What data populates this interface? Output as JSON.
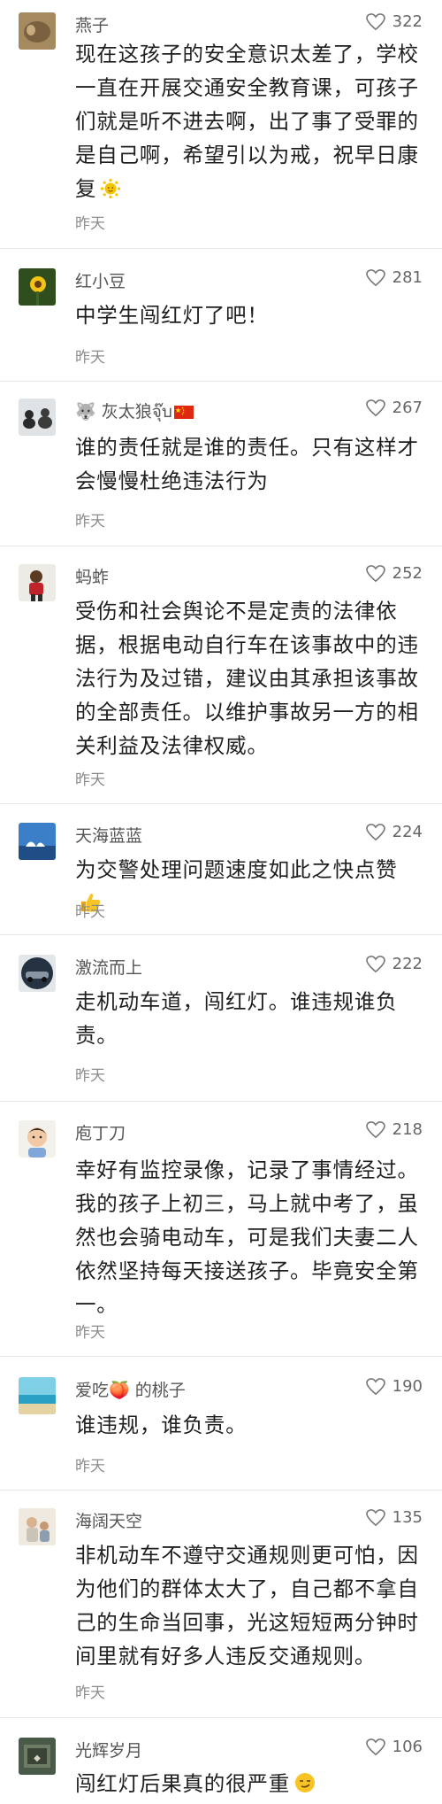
{
  "comments": [
    {
      "name": "燕子",
      "likes": "322",
      "text": "现在这孩子的安全意识太差了，学校一直在开展交通安全教育课，可孩子们就是听不进去啊，出了事了受罪的是自己啊，希望引以为戒，祝早日康复",
      "emoji": "sun-face-emoji",
      "time": "昨天"
    },
    {
      "name": "红小豆",
      "likes": "281",
      "text": "中学生闯红灯了吧！",
      "time": "昨天"
    },
    {
      "name": "🐺 灰太狼จุ๊บ",
      "likes": "267",
      "text": "谁的责任就是谁的责任。只有这样才会慢慢杜绝违法行为",
      "name_icon": "china-flag-icon",
      "time": "昨天"
    },
    {
      "name": "蚂蚱",
      "likes": "252",
      "text": "受伤和社会舆论不是定责的法律依据，根据电动自行车在该事故中的违法行为及过错，建议由其承担该事故的全部责任。以维护事故另一方的相关利益及法律权威。",
      "time": "昨天"
    },
    {
      "name": "天海蓝蓝",
      "likes": "224",
      "text": "为交警处理问题速度如此之快点赞",
      "emoji": "thumbs-up-emoji",
      "time": "昨天"
    },
    {
      "name": "激流而上",
      "likes": "222",
      "text": "走机动车道，闯红灯。谁违规谁负责。",
      "time": "昨天"
    },
    {
      "name": "庖丁刀",
      "likes": "218",
      "text": "幸好有监控录像，记录了事情经过。我的孩子上初三，马上就中考了，虽然也会骑电动车，可是我们夫妻二人依然坚持每天接送孩子。毕竟安全第一。",
      "time": "昨天"
    },
    {
      "name": "爱吃🍑 的桃子",
      "likes": "190",
      "text": "谁违规，谁负责。",
      "time": "昨天"
    },
    {
      "name": "海阔天空",
      "likes": "135",
      "text": "非机动车不遵守交通规则更可怕，因为他们的群体太大了，自己都不拿自己的生命当回事，光这短短两分钟时间里就有好多人违反交通规则。",
      "time": "昨天"
    },
    {
      "name": "光辉岁月",
      "likes": "106",
      "text": "闯红灯后果真的很严重",
      "emoji": "smirk-face-emoji",
      "time": ""
    }
  ],
  "colors": {
    "text": "#1f1f1f",
    "meta": "#8c8c8c",
    "divider": "#e6e6e6"
  }
}
